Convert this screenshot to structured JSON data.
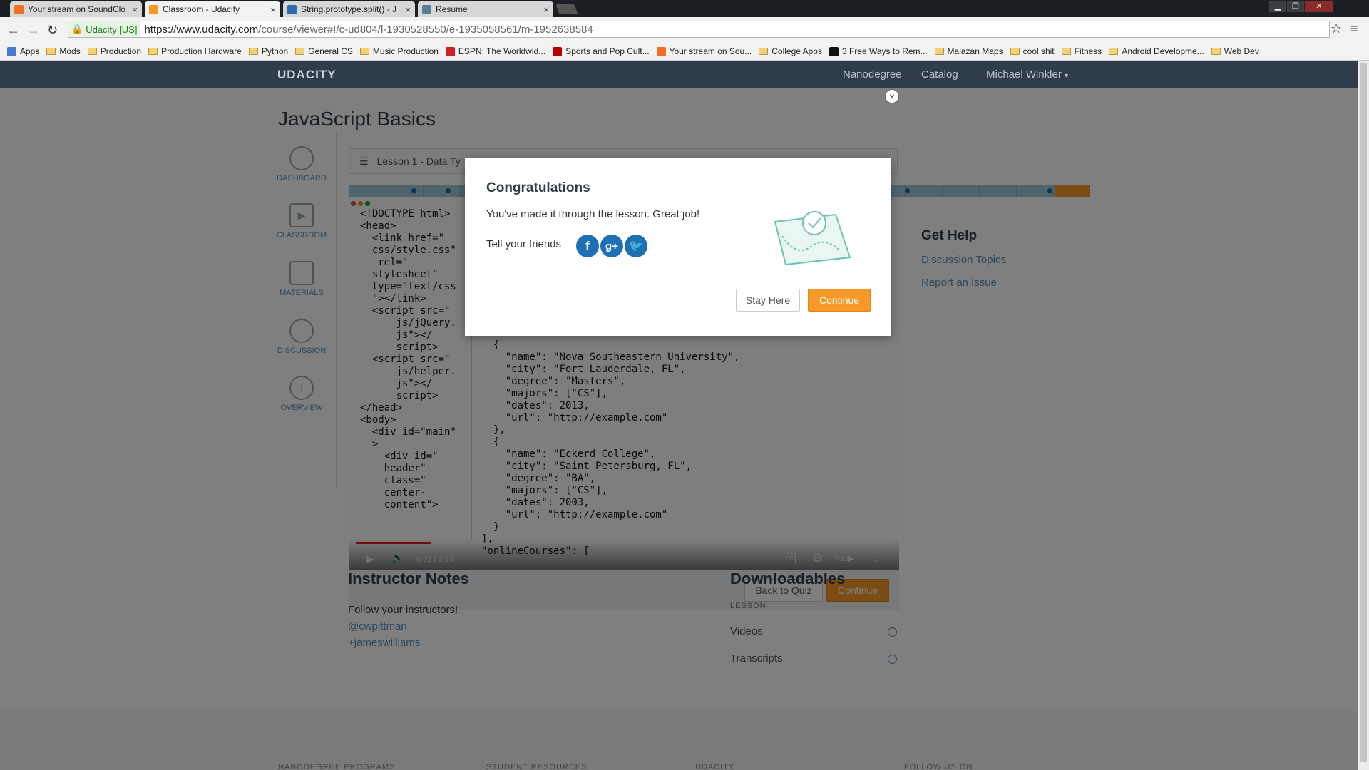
{
  "browser": {
    "tabs": [
      {
        "label": "Your stream on SoundClo",
        "favicon_color": "#f26f23"
      },
      {
        "label": "Classroom - Udacity",
        "favicon_color": "#f79927"
      },
      {
        "label": "String.prototype.split() - J",
        "favicon_color": "#2e6ea8"
      },
      {
        "label": "Resume",
        "favicon_color": "#5b7c99"
      }
    ],
    "secure_label": "Udacity [US]",
    "url_host": "https://www.udacity.com",
    "url_path": "/course/viewer#!/c-ud804/l-1930528550/e-1935058561/m-1952638584",
    "bookmarks": [
      {
        "label": "Apps",
        "icon": "apps-grid-icon"
      },
      {
        "label": "Mods",
        "icon": "folder-icon"
      },
      {
        "label": "Production",
        "icon": "folder-icon"
      },
      {
        "label": "Production Hardware",
        "icon": "folder-icon"
      },
      {
        "label": "Python",
        "icon": "folder-icon"
      },
      {
        "label": "General CS",
        "icon": "folder-icon"
      },
      {
        "label": "Music Production",
        "icon": "folder-icon"
      },
      {
        "label": "ESPN: The Worldwid...",
        "icon": "espn-icon"
      },
      {
        "label": "Sports and Pop Cult...",
        "icon": "grantland-icon"
      },
      {
        "label": "Your stream on Sou...",
        "icon": "soundcloud-icon"
      },
      {
        "label": "College Apps",
        "icon": "folder-icon"
      },
      {
        "label": "3 Free Ways to Rem...",
        "icon": "htg-icon"
      },
      {
        "label": "Malazan Maps",
        "icon": "folder-icon"
      },
      {
        "label": "cool shit",
        "icon": "folder-icon"
      },
      {
        "label": "Fitness",
        "icon": "folder-icon"
      },
      {
        "label": "Android Developme...",
        "icon": "folder-icon"
      },
      {
        "label": "Web Dev",
        "icon": "folder-icon"
      }
    ]
  },
  "site": {
    "logo": "UDACITY",
    "nav": {
      "nanodegree": "Nanodegree",
      "catalog": "Catalog",
      "user": "Michael Winkler"
    },
    "page_title": "JavaScript Basics",
    "left_nav": [
      "DASHBOARD",
      "CLASSROOM",
      "MATERIALS",
      "DISCUSSION",
      "OVERVIEW"
    ],
    "lesson_label": "Lesson 1 - Data Ty",
    "code_left": "<!DOCTYPE html>\n<head>\n  <link href=\"\n  css/style.css\"\n   rel=\"\n  stylesheet\"\n  type=\"text/css\n  \"></link>\n  <script src=\"\n      js/jQuery.\n      js\"></\n      script>\n  <script src=\"\n      js/helper.\n      js\"></\n      script>\n</head>\n<body>\n  <div id=\"main\"\n  >\n    <div id=\"\n    header\"\n    class=\"\n    center-\n    content\">",
    "code_right": "  {\n    \"name\": \"Nova Southeastern University\",\n    \"city\": \"Fort Lauderdale, FL\",\n    \"degree\": \"Masters\",\n    \"majors\": [\"CS\"],\n    \"dates\": 2013,\n    \"url\": \"http://example.com\"\n  },\n  {\n    \"name\": \"Eckerd College\",\n    \"city\": \"Saint Petersburg, FL\",\n    \"degree\": \"BA\",\n    \"majors\": [\"CS\"],\n    \"dates\": 2003,\n    \"url\": \"http://example.com\"\n  }\n],\n\"onlineCourses\": [",
    "video_time": "0:02 / 0:14",
    "video_progress": 0.14,
    "back_to_quiz": "Back to Quiz",
    "continue": "Continue",
    "get_help": "Get Help",
    "discussion_topics": "Discussion Topics",
    "report_issue": "Report an Issue",
    "instructor_notes_title": "Instructor Notes",
    "instructor_notes": [
      "Follow your instructors!",
      "@cwpittman",
      "+jameswilliams"
    ],
    "downloadables_title": "Downloadables",
    "downloadables_lesson": "LESSON",
    "downloadables": [
      "Videos",
      "Transcripts"
    ],
    "footer_labels": [
      "NANODEGREE PROGRAMS",
      "STUDENT RESOURCES",
      "UDACITY",
      "FOLLOW US ON"
    ]
  },
  "modal": {
    "title": "Congratulations",
    "message": "You've made it through the lesson. Great job!",
    "tell_friends": "Tell your friends",
    "social": [
      {
        "name": "facebook",
        "glyph": "f",
        "color": "#1f6fb5"
      },
      {
        "name": "google-plus",
        "glyph": "g+",
        "color": "#1f6fb5"
      },
      {
        "name": "twitter",
        "glyph": "t",
        "color": "#1f6fb5"
      }
    ],
    "stay_here": "Stay Here",
    "continue": "Continue",
    "close_glyph": "×"
  },
  "colors": {
    "accent": "#f79927",
    "navbar": "#2e3d49",
    "link": "#5a8fb8"
  }
}
